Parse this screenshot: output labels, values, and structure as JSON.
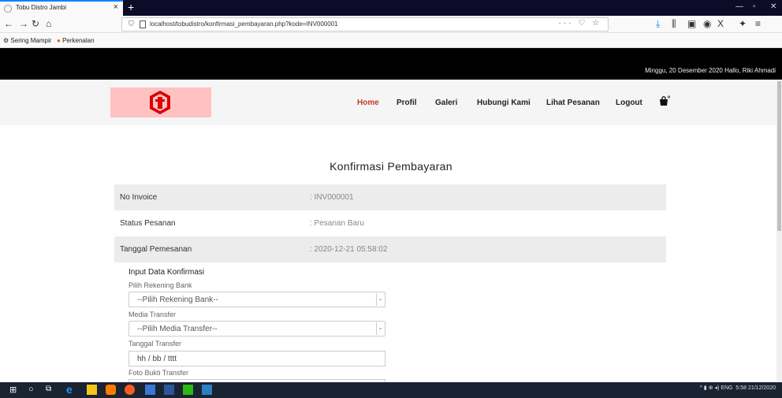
{
  "browser": {
    "tab_title": "Tobu Distro Jambi",
    "url": "localhost/tobudistro/konfirmasi_pembayaran.php?kode=INV000001",
    "bookmarks": [
      "Sering Mampir",
      "Perkenalan"
    ]
  },
  "topbar": {
    "info": "Minggu, 20 Desember 2020   Hallo, Riki Ahmadi"
  },
  "nav": {
    "items": [
      "Home",
      "Profil",
      "Galeri",
      "Hubungi Kami",
      "Lihat Pesanan",
      "Logout"
    ],
    "active": "Home"
  },
  "page": {
    "title": "Konfirmasi Pembayaran",
    "details": [
      {
        "label": "No Invoice",
        "value": ": INV000001"
      },
      {
        "label": "Status Pesanan",
        "value": ": Pesanan Baru"
      },
      {
        "label": "Tanggal Pemesanan",
        "value": ": 2020-12-21 05:58:02"
      }
    ]
  },
  "form": {
    "title": "Input Data Konfirmasi",
    "bank_label": "Pilih Rekening Bank",
    "bank_value": "--Pilih Rekening Bank--",
    "media_label": "Media Transfer",
    "media_value": "--Pilih Media Transfer--",
    "date_label": "Tanggal Transfer",
    "date_value": "hh / bb / tttt",
    "photo_label": "Foto Bukti Transfer"
  },
  "taskbar": {
    "tray": "ENG",
    "time": "5:58",
    "date": "21/12/2020"
  },
  "colors": {
    "accent": "#c0392b",
    "logo_bg": "#ffc1c1"
  }
}
